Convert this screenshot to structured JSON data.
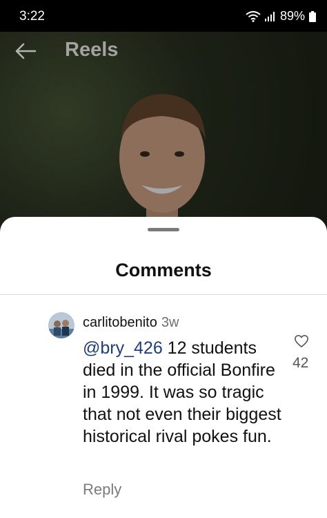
{
  "status_bar": {
    "time": "3:22",
    "battery": "89%",
    "wifi_icon": "wifi-icon",
    "signal_icon": "signal-icon",
    "battery_icon": "battery-icon"
  },
  "header": {
    "title": "Reels",
    "back_icon": "back-arrow-icon"
  },
  "sheet": {
    "title": "Comments"
  },
  "comment": {
    "username": "carlitobenito",
    "time": "3w",
    "mention": "@bry_426",
    "text": " 12 students died in the official Bonfire in 1999. It was so tragic that not even their biggest historical rival pokes fun.",
    "likes": "42",
    "reply_label": "Reply"
  },
  "colors": {
    "mention": "#1f3d7a",
    "muted": "#7a7a7a",
    "sheet_bg": "#ffffff"
  }
}
